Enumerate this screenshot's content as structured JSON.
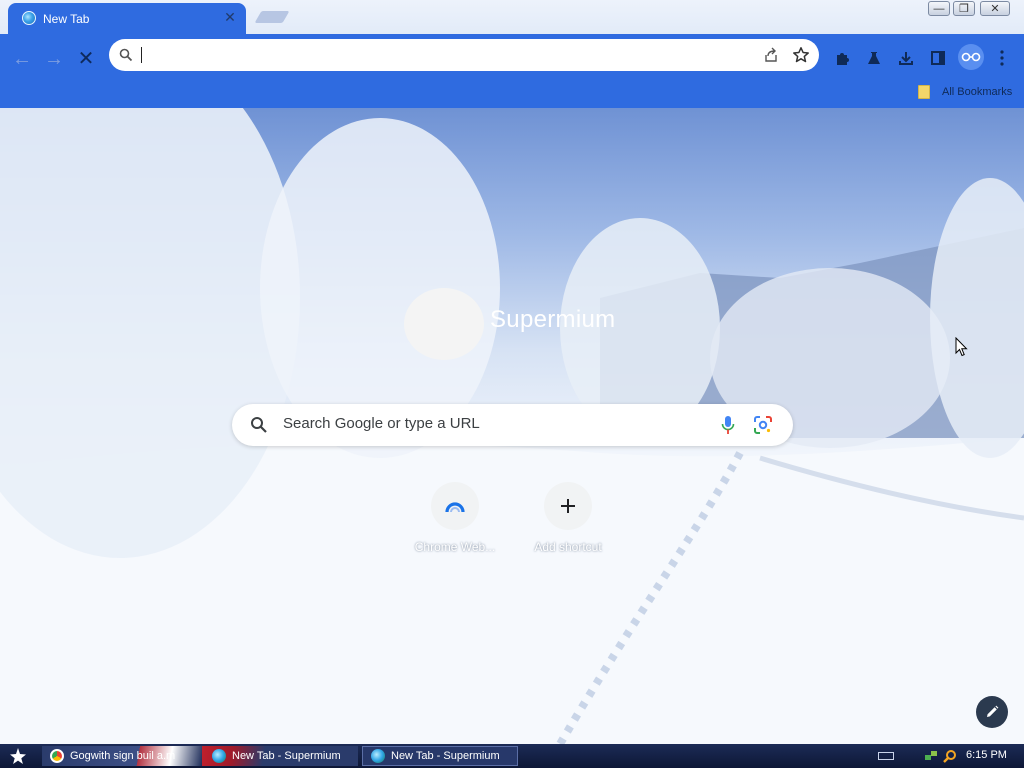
{
  "tab": {
    "title": "New Tab",
    "close_symbol": "✕"
  },
  "window_controls": {
    "minimize": "—",
    "restore": "❐",
    "close": "✕"
  },
  "toolbar": {
    "back_symbol": "←",
    "forward_symbol": "→",
    "stop_symbol": "✕",
    "omnibox_value": "",
    "bookmarks_label": "All Bookmarks"
  },
  "ntp": {
    "logo_text": "Supermium",
    "search_placeholder": "Search Google or type a URL",
    "shortcuts": [
      {
        "label": "Chrome Web...",
        "icon": "chrome-web-store-icon"
      },
      {
        "label": "Add shortcut",
        "icon": "plus-icon"
      }
    ]
  },
  "taskbar": {
    "tasks": [
      {
        "label": "Gogwith sign  buil a.m"
      },
      {
        "label": "New Tab - Supermium"
      },
      {
        "label": "New Tab - Supermium"
      }
    ],
    "clock": "6:15 PM"
  },
  "colors": {
    "accent": "#2f6be0",
    "taskbar": "#13214a"
  }
}
